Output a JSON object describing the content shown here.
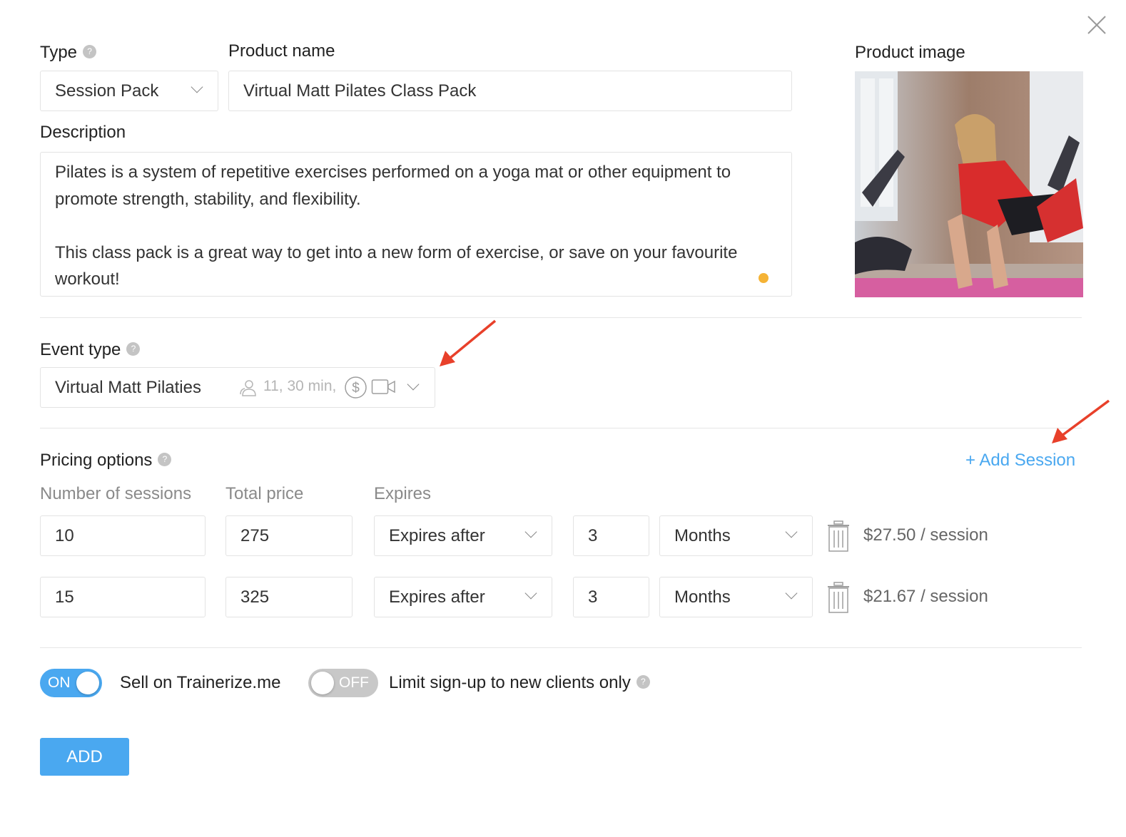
{
  "type_field": {
    "label": "Type",
    "value": "Session Pack",
    "help": "?"
  },
  "product_name": {
    "label": "Product name",
    "value": "Virtual Matt Pilates Class Pack"
  },
  "description": {
    "label": "Description",
    "paragraph_1": "Pilates is a system of repetitive exercises performed on a yoga mat or other equipment to promote strength, stability, and flexibility.",
    "paragraph_2": "This class pack is a great way to get into a new form of exercise, or save on your favourite workout!"
  },
  "product_image": {
    "label": "Product image"
  },
  "event_type": {
    "label": "Event type",
    "help": "?",
    "value": "Virtual Matt Pilaties",
    "meta": "11, 30 min,"
  },
  "pricing": {
    "label": "Pricing options",
    "help": "?",
    "add_session": "+ Add Session",
    "col_sessions": "Number of sessions",
    "col_price": "Total price",
    "col_expires": "Expires",
    "rows": [
      {
        "sessions": "10",
        "price": "275",
        "expires_mode": "Expires after",
        "expires_count": "3",
        "expires_unit": "Months",
        "per_session": "$27.50 / session"
      },
      {
        "sessions": "15",
        "price": "325",
        "expires_mode": "Expires after",
        "expires_count": "3",
        "expires_unit": "Months",
        "per_session": "$21.67 / session"
      }
    ]
  },
  "toggles": {
    "sell": {
      "state": "ON",
      "label": "Sell on Trainerize.me"
    },
    "limit": {
      "state": "OFF",
      "label": "Limit sign-up to new clients only",
      "help": "?"
    }
  },
  "add_button": "ADD",
  "colors": {
    "accent": "#4aa8f0",
    "annotation_arrow": "#e8402a",
    "toggle_off": "#c8c8c8"
  }
}
